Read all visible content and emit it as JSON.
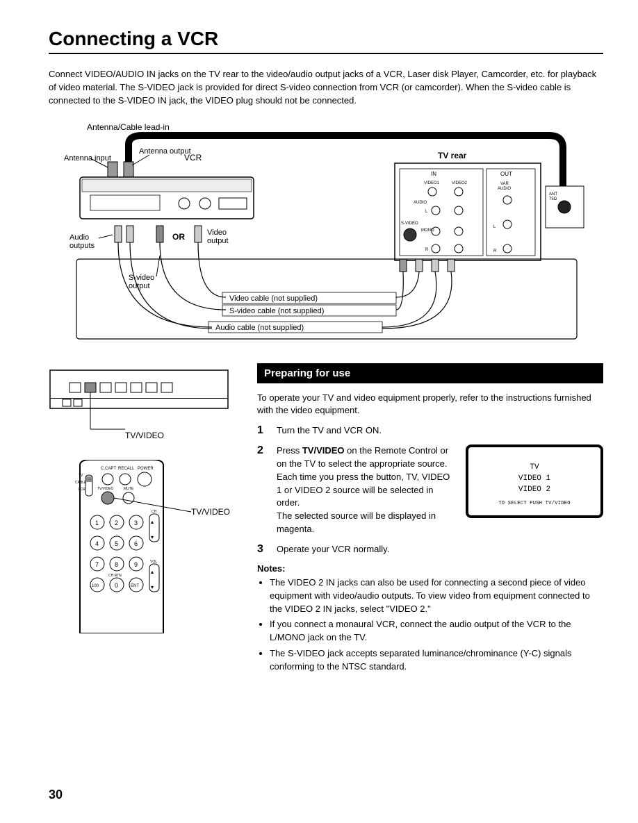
{
  "title": "Connecting a VCR",
  "intro": "Connect VIDEO/AUDIO IN jacks on the TV rear to the video/audio output jacks of a VCR, Laser disk Player, Camcorder, etc. for playback of video material. The S-VIDEO jack is provided for direct S-video connection from VCR (or camcorder). When the S-video cable is connected to the S-VIDEO IN jack, the VIDEO plug should not be connected.",
  "diagram": {
    "antenna_leadin": "Antenna/Cable lead-in",
    "antenna_input": "Antenna input",
    "antenna_output": "Antenna output",
    "vcr": "VCR",
    "tv_rear": "TV rear",
    "audio_outputs": "Audio outputs",
    "or": "OR",
    "video_output": "Video output",
    "svideo_output": "S-video output",
    "video_cable": "Video cable (not supplied)",
    "svideo_cable": "S-video cable (not supplied)",
    "audio_cable": "Audio cable (not supplied)",
    "in_label": "IN",
    "out_label": "OUT",
    "video1": "VIDEO1",
    "video2": "VIDEO2",
    "var_audio": "VAR AUDIO",
    "audio": "AUDIO",
    "svideo": "S-VIDEO",
    "mono": "MONO",
    "l": "L",
    "r": "R",
    "ant": "ANT 75Ω"
  },
  "section_header": "Preparing for use",
  "prep_intro": "To operate your TV and video equipment properly, refer to the instructions furnished with the video equipment.",
  "steps": {
    "s1": "Turn the TV and VCR ON.",
    "s2a": "Press ",
    "s2b_bold": "TV/VIDEO",
    "s2c": " on the Remote Control or on the TV to select the appropriate source.",
    "s2d": "Each time you press the button, TV, VIDEO 1 or VIDEO 2 source will be selected in order.",
    "s2e": "The selected source will be displayed in magenta.",
    "s3": "Operate your VCR normally."
  },
  "screen": {
    "line1": "TV",
    "line2": "VIDEO 1",
    "line3": "VIDEO 2",
    "footer": "TO SELECT PUSH TV/VIDEO"
  },
  "notes_head": "Notes:",
  "notes": [
    "The VIDEO 2 IN jacks can also be used for connecting a second piece of video equipment with video/audio outputs. To view video from equipment connected to the VIDEO 2 IN jacks, select \"VIDEO 2.\"",
    "If you connect a monaural VCR, connect the audio output of the VCR to the L/MONO jack on the TV.",
    "The S-VIDEO jack accepts separated luminance/chrominance (Y-C) signals conforming to the NTSC standard."
  ],
  "tvvideo_label": "TV/VIDEO",
  "remote_label": "TV/VIDEO",
  "remote_buttons": {
    "ccapt": "C.CAPT",
    "recall": "RECALL",
    "power": "POWER",
    "tv": "TV",
    "cable": "CABLE",
    "vcr": "VCR",
    "tvvideo": "TV/VIDEO",
    "mute": "MUTE",
    "ch": "CH",
    "vol": "VOL",
    "chrtn": "CH RTN",
    "ent": "ENT",
    "n100": "100"
  },
  "page_number": "30"
}
